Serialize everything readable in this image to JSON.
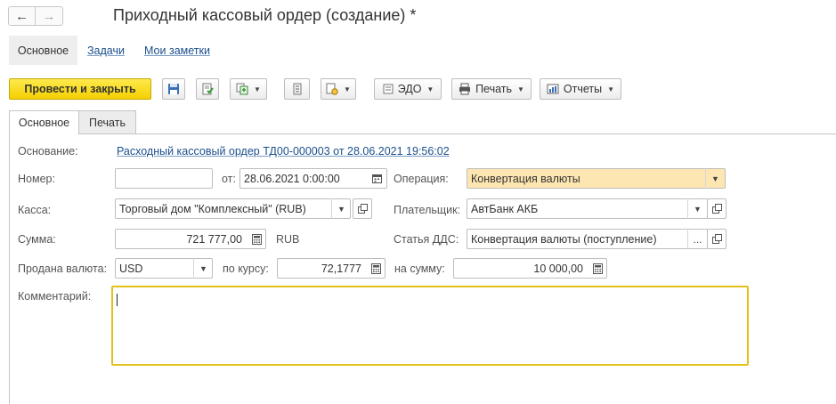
{
  "window": {
    "title": "Приходный кассовый ордер (создание) *"
  },
  "sections": {
    "main": "Основное",
    "tasks": "Задачи",
    "notes": "Мои заметки"
  },
  "toolbar": {
    "post_close": "Провести и закрыть",
    "edo": "ЭДО",
    "print": "Печать",
    "reports": "Отчеты"
  },
  "tabs": {
    "main": "Основное",
    "print": "Печать"
  },
  "form": {
    "basis_label": "Основание:",
    "basis_link": "Расходный кассовый ордер ТД00-000003 от 28.06.2021 19:56:02",
    "number_label": "Номер:",
    "number_value": "",
    "date_label": "от:",
    "date_value": "28.06.2021  0:00:00",
    "operation_label": "Операция:",
    "operation_value": "Конвертация валюты",
    "cashbox_label": "Касса:",
    "cashbox_value": "Торговый дом \"Комплексный\" (RUB)",
    "payer_label": "Плательщик:",
    "payer_value": "АвтБанк АКБ",
    "amount_label": "Сумма:",
    "amount_value": "721 777,00",
    "amount_currency": "RUB",
    "dds_label": "Статья ДДС:",
    "dds_value": "Конвертация валюты (поступление)",
    "sold_currency_label": "Продана валюта:",
    "sold_currency_value": "USD",
    "rate_label": "по курсу:",
    "rate_value": "72,1777",
    "sum_label": "на сумму:",
    "sum_value": "10 000,00",
    "comment_label": "Комментарий:",
    "comment_value": ""
  },
  "icons": {
    "back": "arrow-left-icon",
    "forward": "arrow-right-icon",
    "save": "floppy-disk-icon",
    "post": "post-document-icon",
    "create_based": "create-based-on-icon",
    "structure": "document-structure-icon",
    "docs": "related-documents-icon",
    "calendar": "calendar-icon",
    "calculator": "calculator-icon",
    "open": "open-form-icon"
  },
  "colors": {
    "primary_button": "#f4cf00",
    "highlight_field": "#fde6b1",
    "link": "#1c4f8c",
    "focus_border": "#e3c11d"
  }
}
